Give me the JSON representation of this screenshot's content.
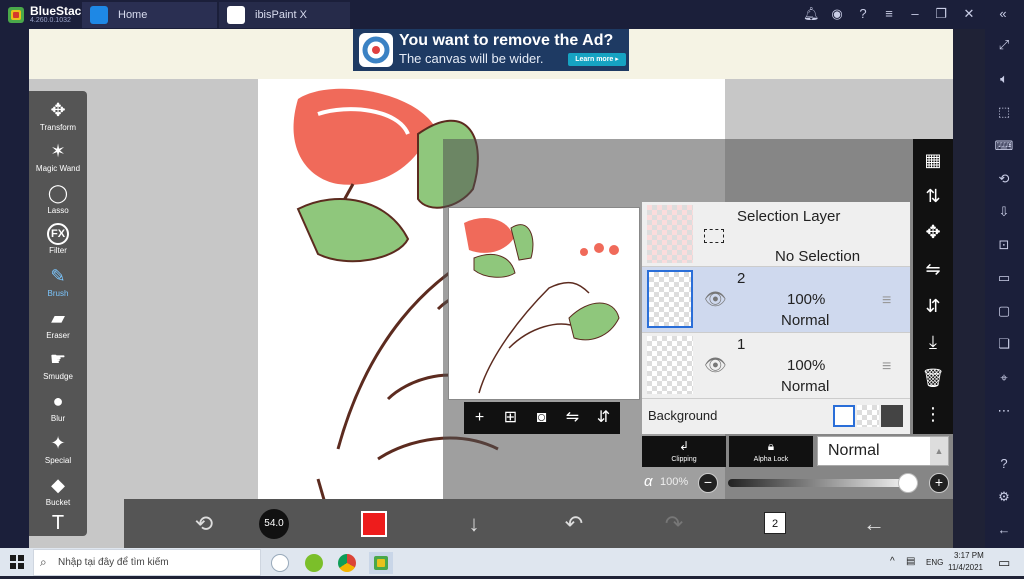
{
  "bluestacks": {
    "name": "BlueStacks",
    "version": "4.260.0.1032",
    "tabs": [
      {
        "label": "Home"
      },
      {
        "label": "ibisPaint X"
      }
    ]
  },
  "ad": {
    "line1": "You want to remove the Ad?",
    "line2": "The canvas will be wider.",
    "button": "Learn more ▸"
  },
  "tools": [
    {
      "label": "Transform",
      "icon": "✥"
    },
    {
      "label": "Magic Wand",
      "icon": "✶"
    },
    {
      "label": "Lasso",
      "icon": "◯"
    },
    {
      "label": "Filter",
      "icon": "FX"
    },
    {
      "label": "Brush",
      "icon": "✎"
    },
    {
      "label": "Eraser",
      "icon": "▰"
    },
    {
      "label": "Smudge",
      "icon": "☛"
    },
    {
      "label": "Blur",
      "icon": "●"
    },
    {
      "label": "Special",
      "icon": "✦"
    },
    {
      "label": "Bucket",
      "icon": "◆"
    },
    {
      "label": "",
      "icon": "T"
    }
  ],
  "brush_size": "54.0",
  "layers": {
    "selection": {
      "title": "Selection Layer",
      "status": "No Selection"
    },
    "items": [
      {
        "name": "2",
        "opacity": "100%",
        "blend": "Normal"
      },
      {
        "name": "1",
        "opacity": "100%",
        "blend": "Normal"
      }
    ],
    "background_label": "Background"
  },
  "clipping_label": "Clipping",
  "alpha_lock_label": "Alpha Lock",
  "blend_mode": "Normal",
  "opacity": {
    "symbol": "α",
    "value": "100%",
    "fraction": 1.0
  },
  "layer_count": "2",
  "taskbar": {
    "search_placeholder": "Nhập tại đây để tìm kiếm",
    "lang": "ENG",
    "time": "3:17 PM",
    "date": "11/4/2021"
  }
}
